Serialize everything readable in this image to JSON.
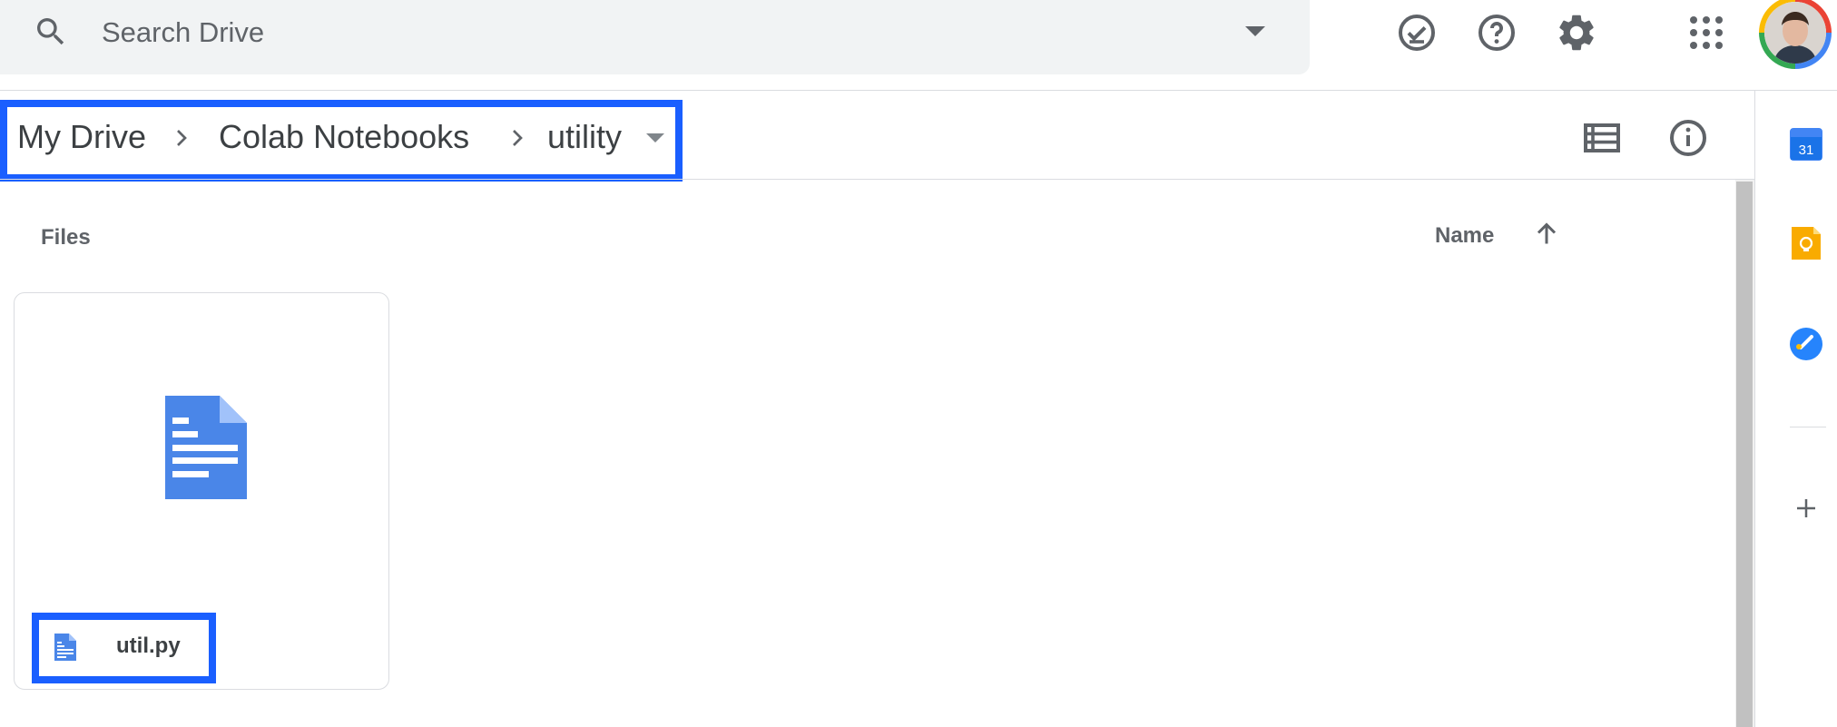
{
  "search": {
    "placeholder": "Search Drive"
  },
  "header": {
    "icons": [
      "offline-ready-icon",
      "help-icon",
      "settings-icon",
      "apps-grid-icon"
    ],
    "avatar": "account-avatar"
  },
  "breadcrumb": {
    "items": [
      {
        "label": "My Drive"
      },
      {
        "label": "Colab Notebooks"
      },
      {
        "label": "utility"
      }
    ],
    "highlight_color": "#1a5fff"
  },
  "toolbar": {
    "icons": [
      "list-view-icon",
      "details-info-icon"
    ]
  },
  "files": {
    "section_label": "Files",
    "sort_label": "Name",
    "sort_direction": "ascending",
    "items": [
      {
        "name": "util.py",
        "type": "document"
      }
    ]
  },
  "side_panel": {
    "icons": [
      "calendar-icon",
      "keep-icon",
      "tasks-icon",
      "add-icon"
    ],
    "calendar_day": "31"
  },
  "colors": {
    "doc_blue": "#4a86e8",
    "highlight": "#1a5fff",
    "keep_yellow": "#f9ab00"
  }
}
